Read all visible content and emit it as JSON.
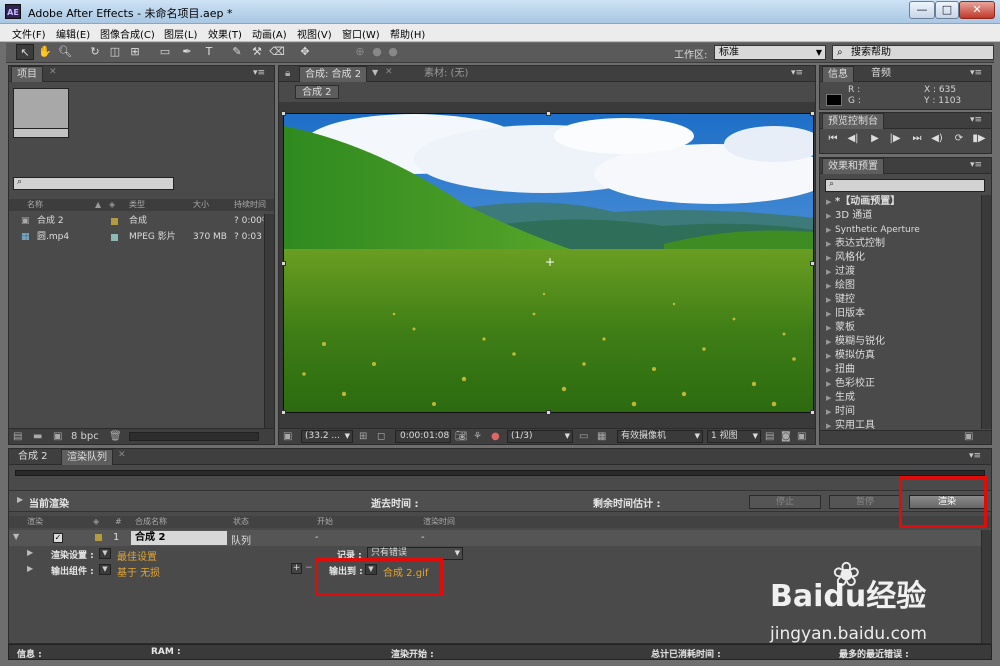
{
  "window": {
    "title": "Adobe After Effects - 未命名项目.aep *",
    "app_icon": "AE",
    "minimize": "—",
    "maximize": "□",
    "close": "✕"
  },
  "menus": [
    "文件(F)",
    "编辑(E)",
    "图像合成(C)",
    "图层(L)",
    "效果(T)",
    "动画(A)",
    "视图(V)",
    "窗口(W)",
    "帮助(H)"
  ],
  "toolbar": {
    "workspace_label": "工作区:",
    "workspace_value": "标准",
    "help_placeholder": "搜索帮助"
  },
  "project": {
    "tab": "项目",
    "columns": {
      "name": "名称",
      "type": "类型",
      "size": "大小",
      "duration": "持续时间"
    },
    "items": [
      {
        "name": "合成 2",
        "type": "合成",
        "size": "",
        "duration": "? 0:00",
        "color": "#b59a3f"
      },
      {
        "name": "圆.mp4",
        "type": "MPEG 影片",
        "size": "370 MB",
        "duration": "? 0:03",
        "color": "#8fb9b4"
      }
    ],
    "bpc": "8 bpc"
  },
  "composition": {
    "tab_label": "合成: 合成 2",
    "footage_tab": "素材: (无)",
    "chip": "合成 2",
    "zoom": "(33.2 ...",
    "timecode": "0:00:01:08",
    "resolution": "(1/3)",
    "camera": "有效摄像机",
    "view": "1 视图"
  },
  "info": {
    "tab": "信息",
    "audio_tab": "音频",
    "r": "R :",
    "g": "G :",
    "x": "X : 635",
    "y": "Y : 1103"
  },
  "preview": {
    "tab": "预览控制台"
  },
  "effects": {
    "tab": "效果和预置",
    "items": [
      "*【动画预置】",
      "3D 通道",
      "Synthetic Aperture",
      "表达式控制",
      "风格化",
      "过渡",
      "绘图",
      "键控",
      "旧版本",
      "蒙板",
      "模糊与锐化",
      "模拟仿真",
      "扭曲",
      "色彩校正",
      "生成",
      "时间",
      "实用工具"
    ]
  },
  "bottom_tabs": [
    "合成 2",
    "渲染队列"
  ],
  "render_queue": {
    "current_render": "当前渲染",
    "elapsed": "逝去时间 :",
    "remaining": "剩余时间估计 :",
    "stop": "停止",
    "pause": "暂停",
    "render": "渲染",
    "columns": [
      "渲染",
      "#",
      "合成名称",
      "状态",
      "开始",
      "渲染时间"
    ],
    "row": {
      "num": "1",
      "comp": "合成 2",
      "status": "队列",
      "start": "-",
      "render_time": "-"
    },
    "render_settings_label": "渲染设置 :",
    "render_settings_value": "最佳设置",
    "log_label": "记录 :",
    "log_value": "只有错误",
    "output_module_label": "输出组件 :",
    "output_module_value": "基于 无损",
    "output_to_label": "输出到 :",
    "output_to_value": "合成 2.gif"
  },
  "status_bar": {
    "info": "信息 :",
    "ram": "RAM :",
    "render_start": "渲染开始 :",
    "total_time": "总计已消耗时间 :",
    "recent_error": "最多的最近错误 :"
  },
  "watermark": {
    "brand": "Baidu经验",
    "url": "jingyan.baidu.com"
  }
}
